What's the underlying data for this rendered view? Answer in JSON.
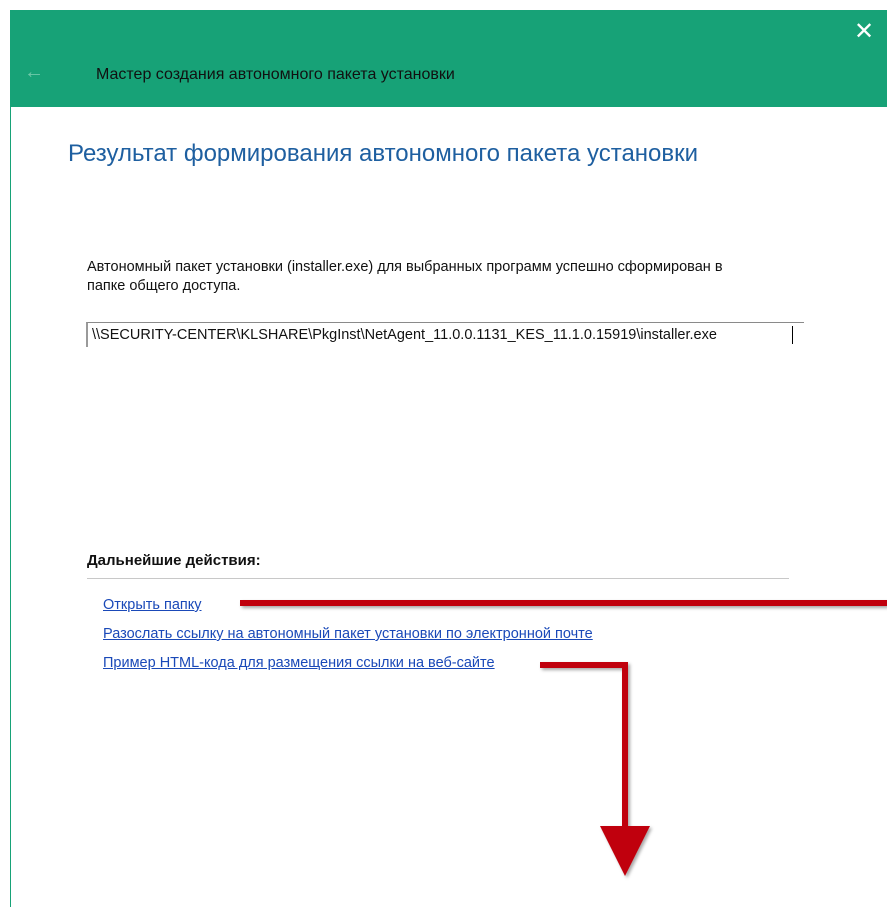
{
  "window": {
    "title": "Мастер создания автономного пакета установки",
    "close_glyph": "✕",
    "back_glyph": "←",
    "accent_color": "#17a277"
  },
  "page": {
    "title": "Результат формирования автономного пакета установки",
    "description": "Автономный пакет установки (installer.exe) для выбранных программ успешно сформирован в папке общего доступа.",
    "path_value": "\\\\SECURITY-CENTER\\KLSHARE\\PkgInst\\NetAgent_11.0.0.1131_KES_11.1.0.15919\\installer.exe"
  },
  "actions": {
    "heading": "Дальнейшие действия:",
    "links": [
      {
        "label": "Открыть папку"
      },
      {
        "label": "Разослать ссылку на автономный пакет установки по электронной почте"
      },
      {
        "label": "Пример HTML-кода для размещения ссылки на веб-сайте"
      }
    ],
    "link_color": "#1a49b8"
  },
  "annotations": {
    "arrow_color": "#c0000a",
    "arrows": [
      "arrow-to-open-folder",
      "arrow-down-from-html-example"
    ]
  }
}
